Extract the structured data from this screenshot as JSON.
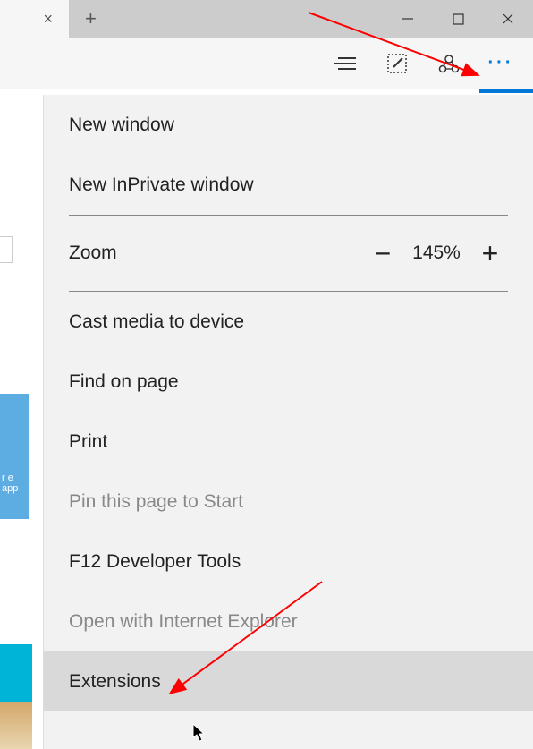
{
  "titlebar": {
    "close_tab_glyph": "×",
    "new_tab_glyph": "+"
  },
  "menu": {
    "new_window": "New window",
    "new_inprivate": "New InPrivate window",
    "zoom_label": "Zoom",
    "zoom_value": "145%",
    "zoom_minus": "−",
    "zoom_plus": "+",
    "cast_media": "Cast media to device",
    "find_on_page": "Find on page",
    "print": "Print",
    "pin_to_start": "Pin this page to Start",
    "f12_tools": "F12 Developer Tools",
    "open_ie": "Open with Internet Explorer",
    "extensions": "Extensions"
  },
  "left_fragments": {
    "tile_text": "r\ne app"
  }
}
